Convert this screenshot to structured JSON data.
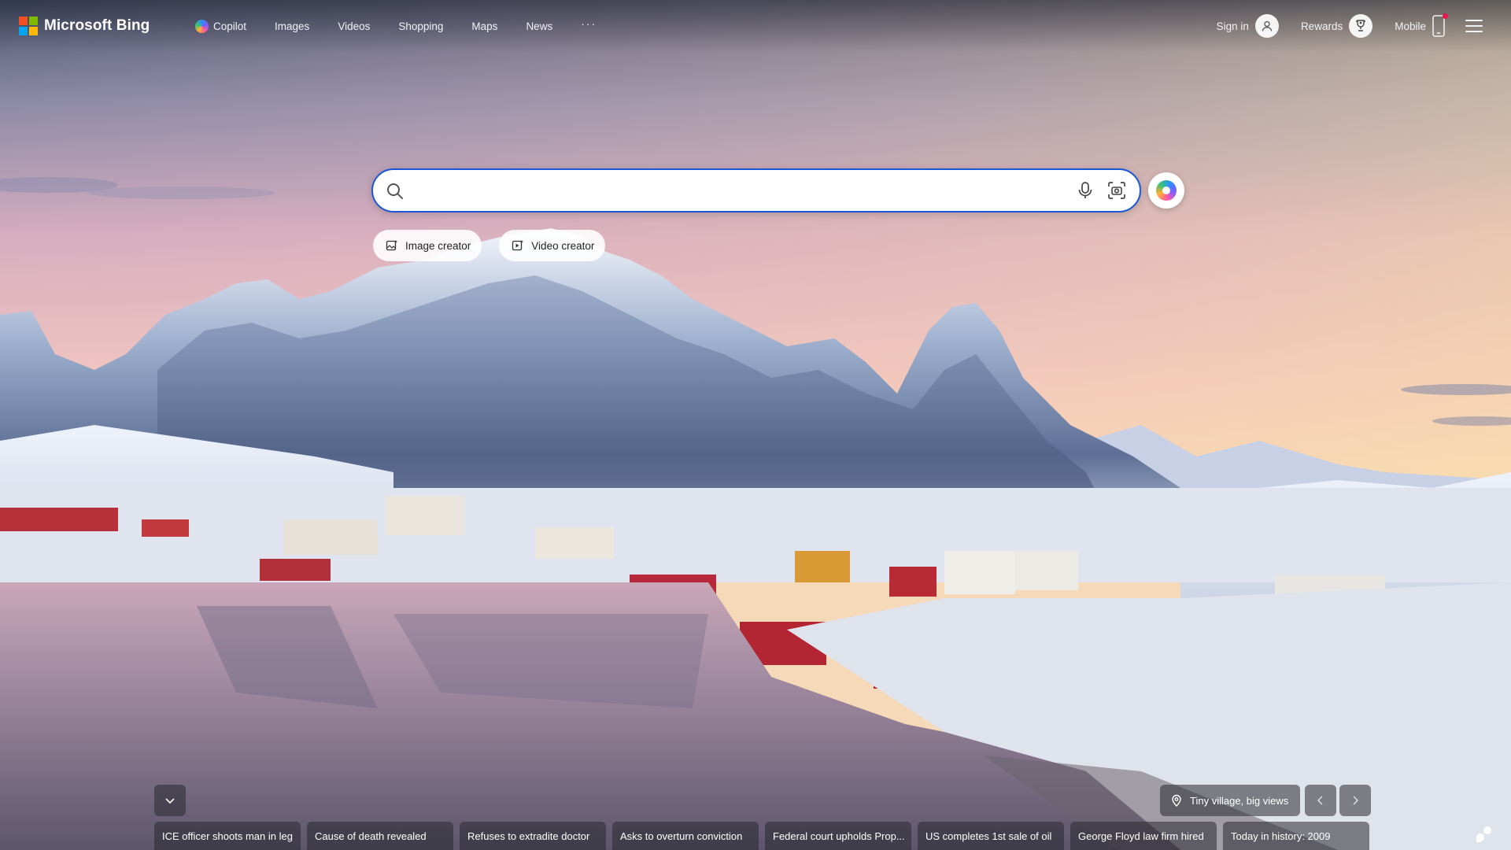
{
  "brand": {
    "name": "Microsoft Bing",
    "logo_colors": [
      "#f25022",
      "#7fba00",
      "#00a4ef",
      "#ffb900"
    ]
  },
  "nav": {
    "items": [
      {
        "label": "Copilot",
        "icon": "copilot-icon"
      },
      {
        "label": "Images"
      },
      {
        "label": "Videos"
      },
      {
        "label": "Shopping"
      },
      {
        "label": "Maps"
      },
      {
        "label": "News"
      }
    ],
    "more": "···"
  },
  "right_nav": {
    "sign_in": "Sign in",
    "rewards": "Rewards",
    "mobile": "Mobile"
  },
  "search": {
    "value": "",
    "placeholder": "",
    "accent_color": "#1a56d6"
  },
  "chips": [
    {
      "label": "Image creator",
      "icon": "image-creator-icon"
    },
    {
      "label": "Video creator",
      "icon": "video-creator-icon"
    }
  ],
  "image_info": {
    "location_title": "Tiny village, big views"
  },
  "news": [
    "ICE officer shoots man in leg",
    "Cause of death revealed",
    "Refuses to extradite doctor",
    "Asks to overturn conviction",
    "Federal court upholds Prop...",
    "US completes 1st sale of oil",
    "George Floyd law firm hired",
    "Today in history: 2009"
  ]
}
